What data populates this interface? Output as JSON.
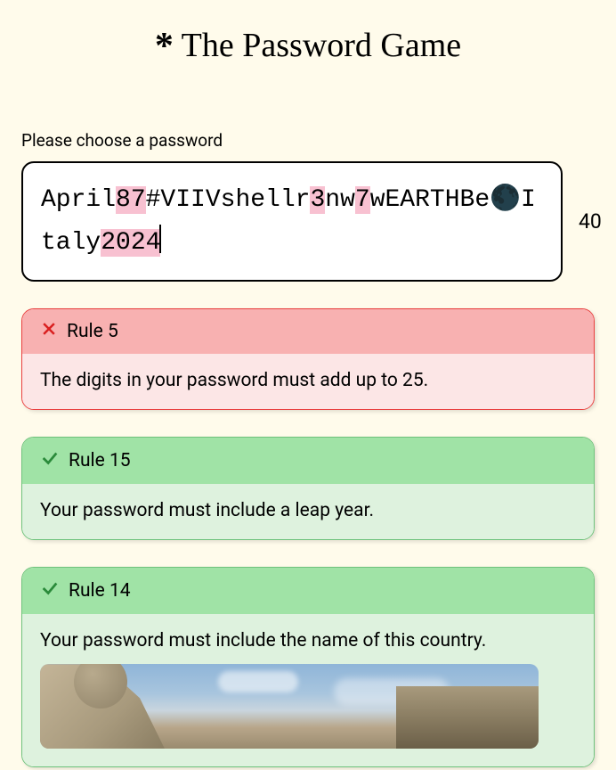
{
  "title": "The Password Game",
  "prompt": "Please choose a password",
  "password": {
    "segments": [
      {
        "text": "April",
        "highlight": false
      },
      {
        "text": "87",
        "highlight": true
      },
      {
        "text": "#VIIVshellr",
        "highlight": false
      },
      {
        "text": "3",
        "highlight": true
      },
      {
        "text": "nw",
        "highlight": false
      },
      {
        "text": "7",
        "highlight": true
      },
      {
        "text": "wEARTHBe🌑Italy",
        "highlight": false
      },
      {
        "text": "2024",
        "highlight": true
      }
    ],
    "length": 40
  },
  "rules": [
    {
      "number": "Rule 5",
      "status": "fail",
      "text": "The digits in your password must add up to 25."
    },
    {
      "number": "Rule 15",
      "status": "pass",
      "text": "Your password must include a leap year."
    },
    {
      "number": "Rule 14",
      "status": "pass",
      "text": "Your password must include the name of this country.",
      "has_image": true
    }
  ]
}
